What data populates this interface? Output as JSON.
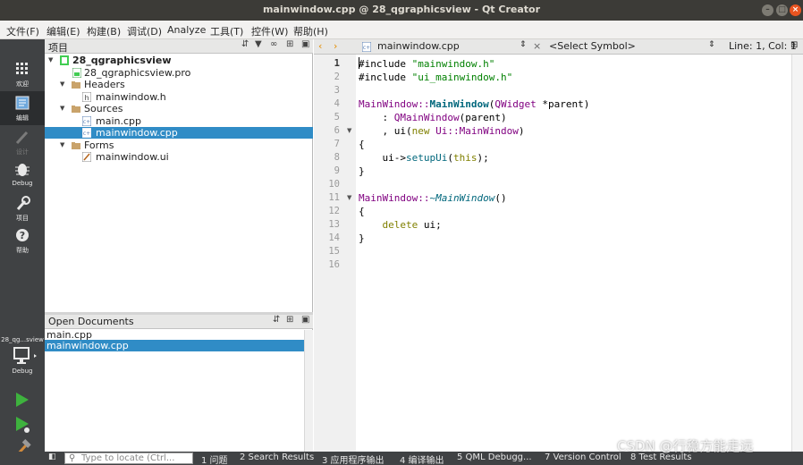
{
  "window": {
    "title": "mainwindow.cpp @ 28_qgraphicsview - Qt Creator"
  },
  "menu": [
    "文件(F)",
    "编辑(E)",
    "构建(B)",
    "调试(D)",
    "Analyze",
    "工具(T)",
    "控件(W)",
    "帮助(H)"
  ],
  "modes": [
    {
      "label": "欢迎",
      "icon": "grid-icon"
    },
    {
      "label": "编辑",
      "icon": "edit-mode-icon"
    },
    {
      "label": "设计",
      "icon": "design-pen-icon"
    },
    {
      "label": "Debug",
      "icon": "bug-icon"
    },
    {
      "label": "项目",
      "icon": "wrench-icon"
    },
    {
      "label": "帮助",
      "icon": "help-icon"
    }
  ],
  "kit": {
    "project": "28_qg...sview",
    "mode": "Debug"
  },
  "projects": {
    "header": "项目",
    "tree": [
      {
        "label": "28_qgraphicsview",
        "bold": true
      },
      {
        "label": "28_qgraphicsview.pro"
      },
      {
        "label": "Headers"
      },
      {
        "label": "mainwindow.h"
      },
      {
        "label": "Sources"
      },
      {
        "label": "main.cpp"
      },
      {
        "label": "mainwindow.cpp",
        "selected": true
      },
      {
        "label": "Forms"
      },
      {
        "label": "mainwindow.ui"
      }
    ]
  },
  "open_documents": {
    "header": "Open Documents",
    "items": [
      {
        "label": "main.cpp"
      },
      {
        "label": "mainwindow.cpp",
        "selected": true
      }
    ]
  },
  "editor": {
    "file": "mainwindow.cpp",
    "symbol": "<Select Symbol>",
    "position": "Line: 1, Col: 1",
    "line_numbers": [
      "1",
      "2",
      "3",
      "4",
      "5",
      "6",
      "7",
      "8",
      "9",
      "10",
      "11",
      "12",
      "13",
      "14",
      "15",
      "16"
    ],
    "lines": [
      "#include \"mainwindow.h\"",
      "#include \"ui_mainwindow.h\"",
      "",
      "MainWindow::MainWindow(QWidget *parent)",
      "    : QMainWindow(parent)",
      "    , ui(new Ui::MainWindow)",
      "{",
      "    ui->setupUi(this);",
      "}",
      "",
      "MainWindow::~MainWindow()",
      "{",
      "    delete ui;",
      "}",
      "",
      ""
    ]
  },
  "status": {
    "locate_placeholder": "Type to locate (Ctrl...",
    "panes": [
      "1 问题",
      "2 Search Results",
      "3 应用程序输出",
      "4 编译输出",
      "5 QML Debugg...",
      "7 Version Control",
      "8 Test Results"
    ]
  },
  "watermark": "CSDN @行稳方能走远",
  "colors": {
    "selection": "#308cc6",
    "modebar": "#404244",
    "keyword": "#808000",
    "string": "#008000",
    "type": "#800080"
  }
}
